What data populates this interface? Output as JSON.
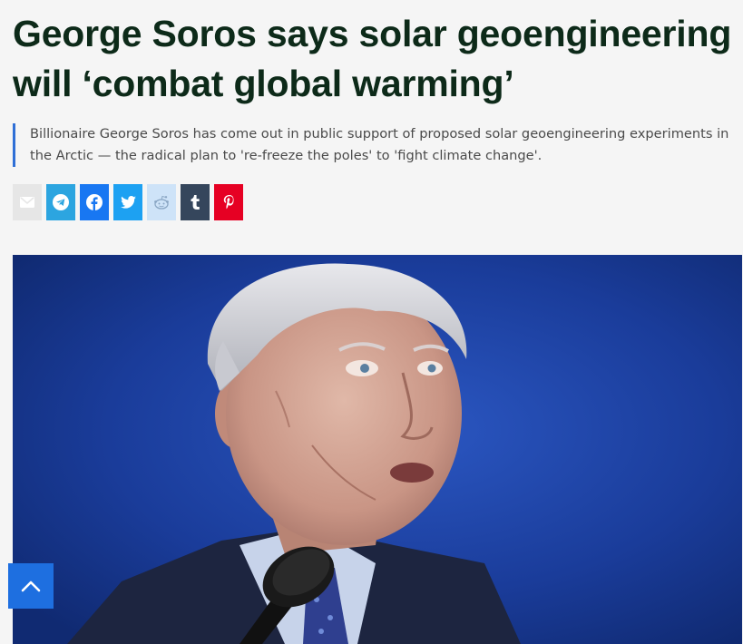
{
  "article": {
    "headline": "George Soros says solar geoengineering will ‘combat global warming’",
    "dek": "Billionaire George Soros has come out in public support of proposed solar geoengineering experiments in the Arctic — the radical plan to 're-freeze the poles' to 'fight climate change'."
  },
  "share": {
    "buttons": [
      {
        "icon": "email-icon",
        "color": "#e6e6e6"
      },
      {
        "icon": "telegram-icon",
        "color": "#2ca5e0"
      },
      {
        "icon": "facebook-icon",
        "color": "#1877f2"
      },
      {
        "icon": "twitter-icon",
        "color": "#1da1f2"
      },
      {
        "icon": "reddit-icon",
        "color": "#cee3f8"
      },
      {
        "icon": "tumblr-icon",
        "color": "#35465c"
      },
      {
        "icon": "pinterest-icon",
        "color": "#e60023"
      }
    ]
  },
  "colors": {
    "headline": "#0d2a19",
    "accent": "#2f6fd6",
    "back_to_top": "#1e6fe0",
    "hero_background": "#1a3c9a"
  }
}
